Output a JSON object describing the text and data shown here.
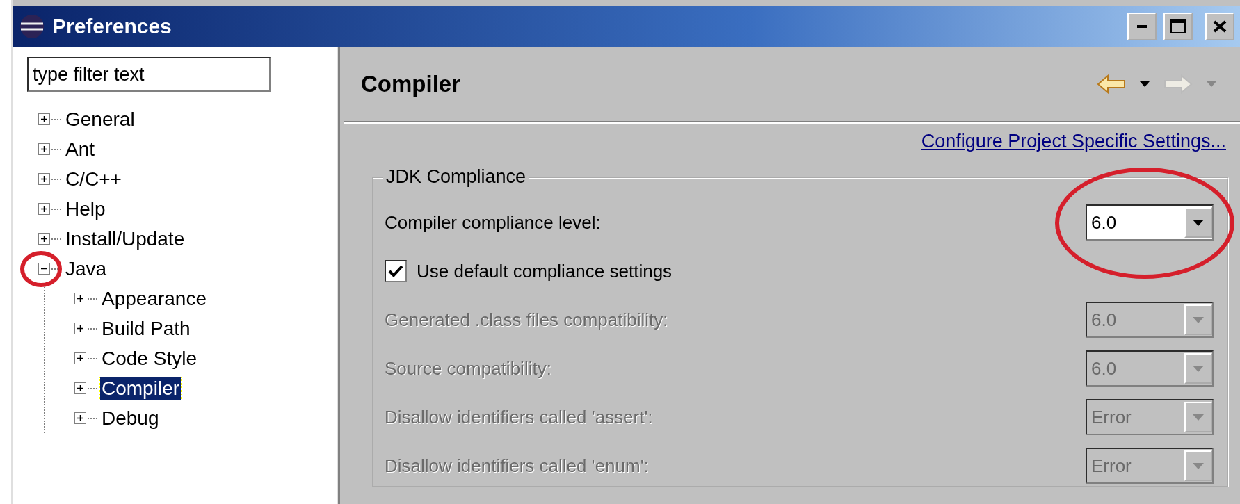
{
  "window": {
    "title": "Preferences"
  },
  "filter": {
    "placeholder": "type filter text"
  },
  "tree": [
    {
      "label": "General",
      "expanded": false,
      "selected": false
    },
    {
      "label": "Ant",
      "expanded": false,
      "selected": false
    },
    {
      "label": "C/C++",
      "expanded": false,
      "selected": false
    },
    {
      "label": "Help",
      "expanded": false,
      "selected": false
    },
    {
      "label": "Install/Update",
      "expanded": false,
      "selected": false
    },
    {
      "label": "Java",
      "expanded": true,
      "selected": false,
      "circled": true,
      "children": [
        {
          "label": "Appearance",
          "expanded": false,
          "selected": false
        },
        {
          "label": "Build Path",
          "expanded": false,
          "selected": false
        },
        {
          "label": "Code Style",
          "expanded": false,
          "selected": false
        },
        {
          "label": "Compiler",
          "expanded": false,
          "selected": true
        },
        {
          "label": "Debug",
          "expanded": false,
          "selected": false
        }
      ]
    }
  ],
  "page": {
    "title": "Compiler",
    "nav": [
      {
        "kind": "back",
        "disabled": false
      },
      {
        "kind": "forward",
        "disabled": true
      }
    ],
    "link": "Configure Project Specific Settings...",
    "group": {
      "title": "JDK Compliance",
      "rows": [
        {
          "kind": "combo",
          "label": "Compiler compliance level:",
          "value": "6.0",
          "disabled": false,
          "circled": true
        },
        {
          "kind": "checkbox",
          "label": "Use default compliance settings",
          "checked": true
        },
        {
          "kind": "combo",
          "label": "Generated .class files compatibility:",
          "value": "6.0",
          "disabled": true
        },
        {
          "kind": "combo",
          "label": "Source compatibility:",
          "value": "6.0",
          "disabled": true
        },
        {
          "kind": "combo",
          "label": "Disallow identifiers called 'assert':",
          "value": "Error",
          "disabled": true
        },
        {
          "kind": "combo",
          "label": "Disallow identifiers called 'enum':",
          "value": "Error",
          "disabled": true
        }
      ]
    }
  }
}
